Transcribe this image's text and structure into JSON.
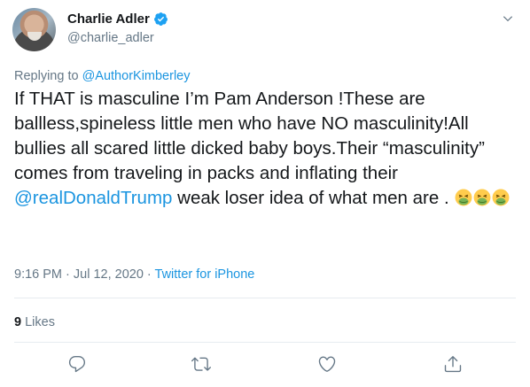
{
  "author": {
    "display_name": "Charlie Adler",
    "handle": "@charlie_adler",
    "verified": true
  },
  "reply": {
    "prefix": "Replying to ",
    "mention": "@AuthorKimberley"
  },
  "tweet": {
    "text_part1": "If THAT is masculine I’m Pam Anderson !These are ballless,spineless little men who have NO masculinity!All bullies all scared little dicked baby boys.Their “masculinity” comes from traveling in packs and inflating their ",
    "mention": "@realDonaldTrump",
    "text_part2": " weak loser idea of what men are . ",
    "emojis": [
      "nauseated-face",
      "nauseated-face",
      "nauseated-face"
    ]
  },
  "meta": {
    "time": "9:16 PM",
    "separator": " · ",
    "date": "Jul 12, 2020",
    "source": "Twitter for iPhone"
  },
  "stats": {
    "likes_count": "9",
    "likes_label": "Likes"
  },
  "colors": {
    "link": "#1b95e0",
    "secondary": "#657786",
    "primary": "#14171a",
    "divider": "#e6ecf0"
  }
}
